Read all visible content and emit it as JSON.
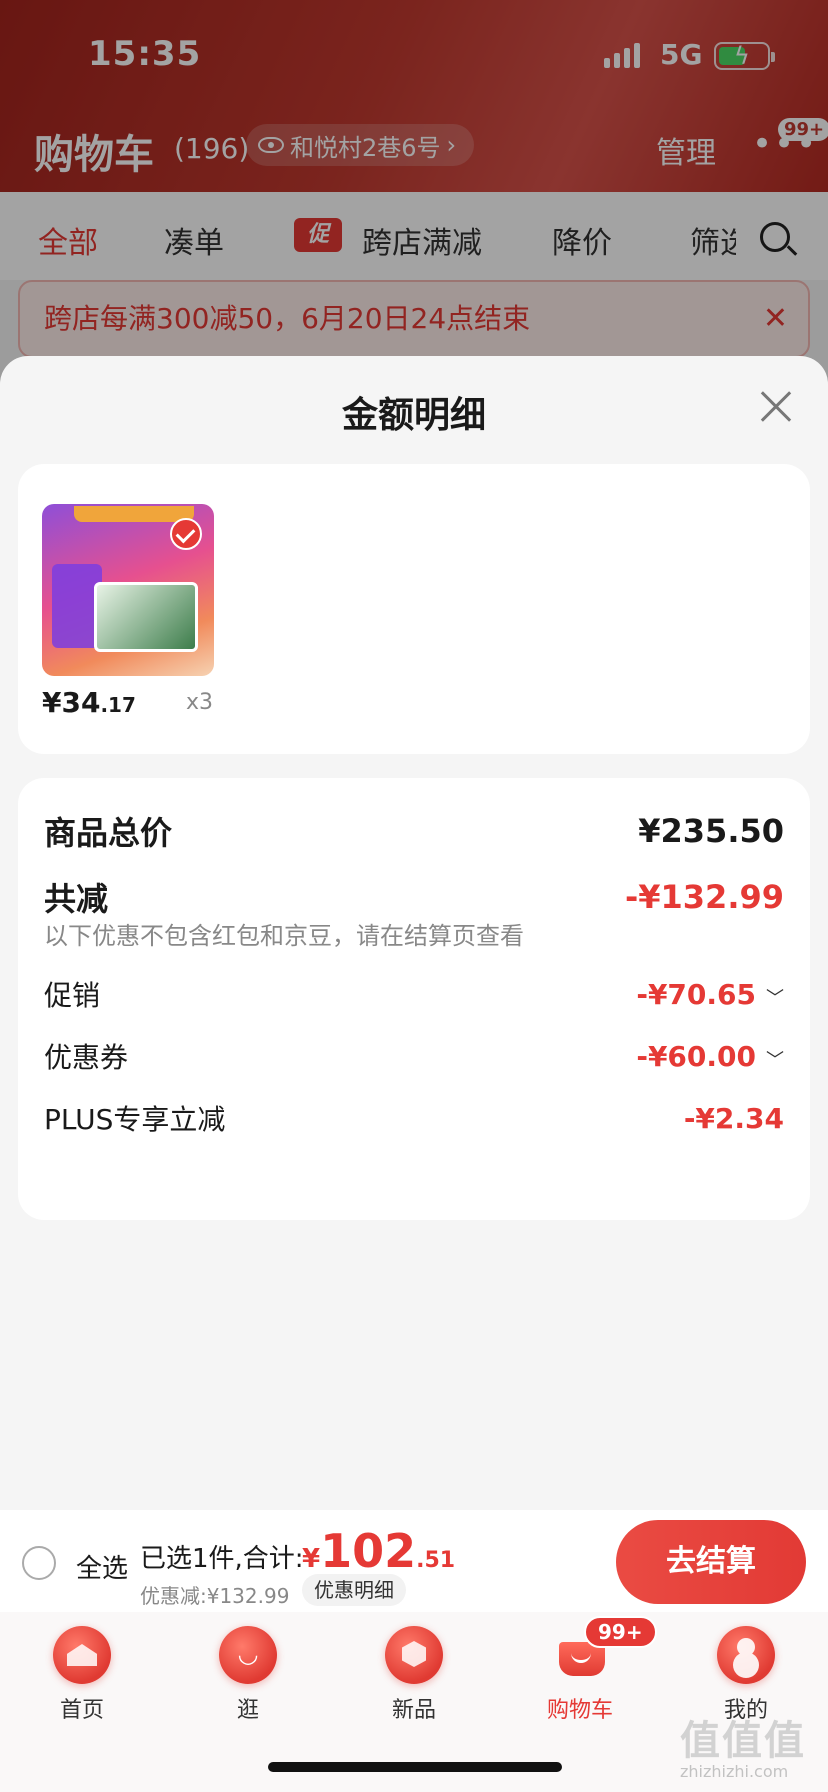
{
  "status": {
    "time": "15:35",
    "network": "5G"
  },
  "header": {
    "title": "购物车",
    "count": "(196)",
    "address": "和悦村2巷6号",
    "manage": "管理",
    "more_badge": "99+"
  },
  "tabs": [
    "全部",
    "凑单",
    "跨店满减",
    "降价",
    "筛选"
  ],
  "tab_promo_tag": "促",
  "promo_banner": "跨店每满300减50，6月20日24点结束",
  "sheet": {
    "title": "金额明细",
    "product": {
      "price_main": "¥34",
      "price_dec": ".17",
      "qty": "x3"
    },
    "total_label": "商品总价",
    "total_value": "¥235.50",
    "reduce_label": "共减",
    "reduce_value": "-¥132.99",
    "note": "以下优惠不包含红包和京豆，请在结算页查看",
    "items": [
      {
        "label": "促销",
        "value": "-¥70.65",
        "expandable": true
      },
      {
        "label": "优惠券",
        "value": "-¥60.00",
        "expandable": true
      },
      {
        "label": "PLUS专享立减",
        "value": "-¥2.34",
        "expandable": false
      }
    ]
  },
  "checkout": {
    "select_all": "全选",
    "summary": "已选1件,合计:",
    "yen": "¥",
    "total_int": "102",
    "total_dec": ".51",
    "discount": "优惠减:¥132.99",
    "detail_button": "优惠明细",
    "submit": "去结算"
  },
  "nav": [
    {
      "label": "首页",
      "icon": "home-icon"
    },
    {
      "label": "逛",
      "icon": "explore-icon"
    },
    {
      "label": "新品",
      "icon": "new-icon"
    },
    {
      "label": "购物车",
      "icon": "cart-icon",
      "active": true
    },
    {
      "label": "我的",
      "icon": "profile-icon"
    }
  ],
  "nav_cart_badge": "99+",
  "watermark": {
    "brand": "值值值",
    "url": "zhizhizhi.com"
  },
  "colors": {
    "accent": "#e53935",
    "header": "#c0392f",
    "sheet_bg": "#f5f5f5"
  }
}
